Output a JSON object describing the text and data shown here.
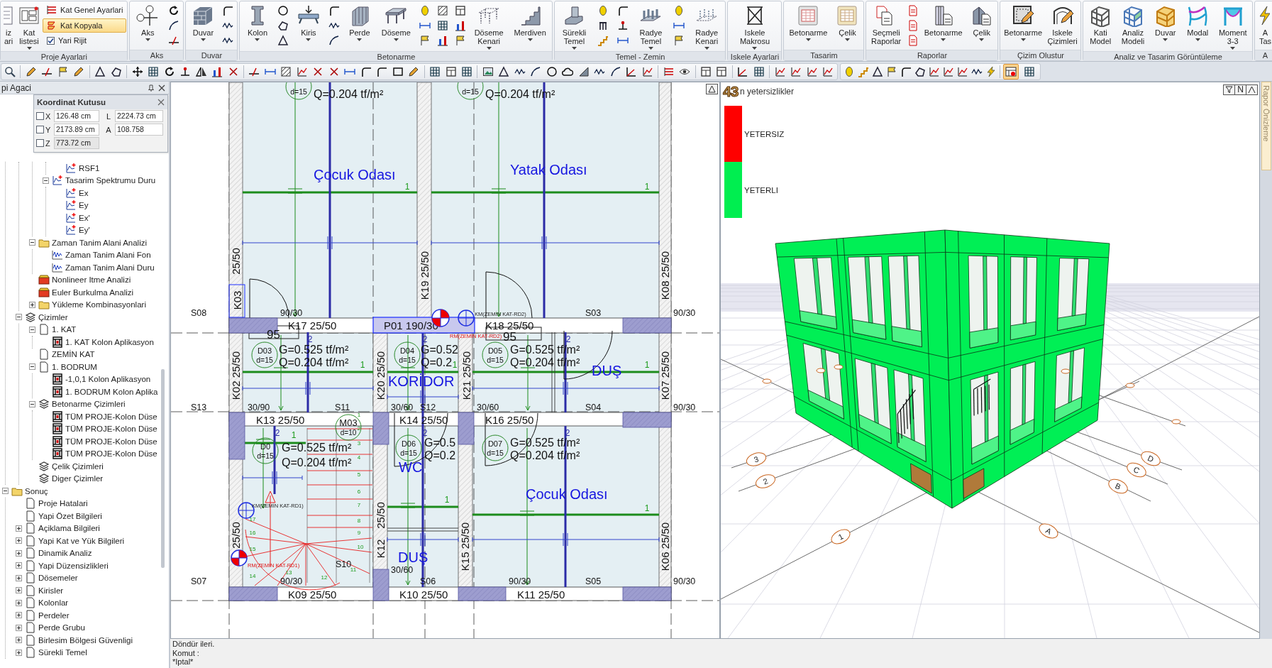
{
  "ribbon": {
    "groups": [
      {
        "label": "Proje Ayarlari",
        "items": [
          {
            "kind": "large",
            "label": "iz ari",
            "dropdown": false
          },
          {
            "kind": "large",
            "label": "Kat listesi",
            "dropdown": true
          },
          {
            "kind": "list",
            "entries": [
              {
                "kind": "button",
                "label": "Kat Genel Ayarlari",
                "selected": false
              },
              {
                "kind": "button",
                "label": "Kat Kopyala",
                "selected": true
              },
              {
                "kind": "checkbox",
                "label": "Yari Rijit",
                "checked": true
              }
            ]
          }
        ]
      },
      {
        "label": "Aks",
        "items": [
          {
            "kind": "large",
            "label": "Aks",
            "dropdown": true
          },
          {
            "kind": "icons"
          }
        ]
      },
      {
        "label": "Duvar",
        "items": [
          {
            "kind": "large",
            "label": "Duvar",
            "dropdown": true
          },
          {
            "kind": "icons"
          }
        ]
      },
      {
        "label": "Betonarme",
        "items": [
          {
            "kind": "large",
            "label": "Kolon",
            "dropdown": true
          },
          {
            "kind": "icons"
          },
          {
            "kind": "large",
            "label": "Kiris",
            "dropdown": true
          },
          {
            "kind": "icons"
          },
          {
            "kind": "large",
            "label": "Perde",
            "dropdown": true
          },
          {
            "kind": "large",
            "label": "Döseme",
            "dropdown": true
          },
          {
            "kind": "icons"
          },
          {
            "kind": "icons"
          },
          {
            "kind": "icons"
          },
          {
            "kind": "large",
            "label": "Döseme Kenari",
            "dropdown": true
          },
          {
            "kind": "large",
            "label": "Merdiven",
            "dropdown": true
          }
        ]
      },
      {
        "label": "Temel - Zemin",
        "items": [
          {
            "kind": "large",
            "label": "Sürekli Temel",
            "dropdown": true
          },
          {
            "kind": "icons"
          },
          {
            "kind": "icons"
          },
          {
            "kind": "large",
            "label": "Radye Temel",
            "dropdown": true
          },
          {
            "kind": "icons"
          },
          {
            "kind": "large",
            "label": "Radye Kenari",
            "dropdown": true
          }
        ]
      },
      {
        "label": "Iskele Ayarlari",
        "items": [
          {
            "kind": "large",
            "label": "Iskele Makrosu",
            "dropdown": true
          }
        ]
      },
      {
        "label": "Tasarim",
        "items": [
          {
            "kind": "large",
            "label": "Betonarme",
            "dropdown": true
          },
          {
            "kind": "large",
            "label": "Çelik",
            "dropdown": true
          }
        ]
      },
      {
        "label": "Raporlar",
        "items": [
          {
            "kind": "large",
            "label": "Seçmeli Raporlar",
            "dropdown": false
          },
          {
            "kind": "icons"
          },
          {
            "kind": "large",
            "label": "Betonarme",
            "dropdown": true
          },
          {
            "kind": "large",
            "label": "Çelik",
            "dropdown": true
          }
        ]
      },
      {
        "label": "Çizim Olustur",
        "items": [
          {
            "kind": "large",
            "label": "Betonarme",
            "dropdown": true
          },
          {
            "kind": "large",
            "label": "Iskele Çizimleri",
            "dropdown": false
          }
        ]
      },
      {
        "label": "Analiz ve Tasarim Görüntüleme",
        "items": [
          {
            "kind": "large",
            "label": "Kati Model",
            "dropdown": false
          },
          {
            "kind": "large",
            "label": "Analiz Modeli",
            "dropdown": false
          },
          {
            "kind": "large",
            "label": "Duvar",
            "dropdown": true
          },
          {
            "kind": "large",
            "label": "Modal",
            "dropdown": true
          },
          {
            "kind": "large",
            "label": "Moment 3-3",
            "dropdown": true
          }
        ]
      },
      {
        "label": "A",
        "items": [
          {
            "kind": "large",
            "label": "A Tas",
            "dropdown": false
          }
        ]
      }
    ]
  },
  "toolbar": {
    "toggles": [
      {
        "pressed": true
      },
      {
        "pressed": false
      }
    ]
  },
  "structure_panel": {
    "title": "pi Agaci",
    "tree": [
      {
        "children": [
          {
            "children": [
              {
                "children": [
                  {
                    "children": [
                      {
                        "label": "RSF1",
                        "kind": "chart"
                      }
                    ]
                  },
                  {
                    "label": "Tasarim Spektrumu Duru",
                    "kind": "chart",
                    "expanded": true,
                    "children": [
                      {
                        "label": "Ex",
                        "kind": "chart"
                      },
                      {
                        "label": "Ey",
                        "kind": "chart"
                      },
                      {
                        "label": "Ex'",
                        "kind": "chart"
                      },
                      {
                        "label": "Ey'",
                        "kind": "chart"
                      }
                    ]
                  }
                ]
              },
              {
                "label": "Zaman Tanim Alani Analizi",
                "kind": "folder",
                "expanded": true,
                "children": [
                  {
                    "label": "Zaman Tanim Alani Fon",
                    "kind": "wave"
                  },
                  {
                    "label": "Zaman Tanim Alani Duru",
                    "kind": "wave"
                  }
                ]
              },
              {
                "label": "Nonlineer Itme Analizi",
                "kind": "box"
              },
              {
                "label": "Euler Burkulma Analizi",
                "kind": "box"
              },
              {
                "label": "Yükleme Kombinasyonlari",
                "kind": "folder",
                "expanded": false
              }
            ]
          },
          {
            "label": "Çizimler",
            "kind": "layers",
            "expanded": true,
            "children": [
              {
                "label": "1. KAT",
                "kind": "page",
                "expanded": true,
                "children": [
                  {
                    "label": "1. KAT Kolon Aplikasyon",
                    "kind": "sheet"
                  }
                ]
              },
              {
                "label": "ZEMİN KAT",
                "kind": "page"
              },
              {
                "label": "1. BODRUM",
                "kind": "page",
                "expanded": true,
                "children": [
                  {
                    "label": "-1,0,1 Kolon Aplikasyon",
                    "kind": "sheet"
                  },
                  {
                    "label": "1. BODRUM Kolon Aplika",
                    "kind": "sheet"
                  }
                ]
              },
              {
                "label": "Betonarme Çizimleri",
                "kind": "layers",
                "expanded": true,
                "children": [
                  {
                    "label": "TÜM PROJE-Kolon Düse",
                    "kind": "sheet"
                  },
                  {
                    "label": "TÜM PROJE-Kolon Düse",
                    "kind": "sheet"
                  },
                  {
                    "label": "TÜM PROJE-Kolon Düse",
                    "kind": "sheet"
                  },
                  {
                    "label": "TÜM PROJE-Kolon Düse",
                    "kind": "sheet"
                  }
                ]
              },
              {
                "label": "Çelik Çizimleri",
                "kind": "layers"
              },
              {
                "label": "Diger Çizimler",
                "kind": "layers"
              }
            ]
          }
        ]
      },
      {
        "label": "Sonuç",
        "kind": "folder",
        "expanded": true,
        "children": [
          {
            "label": "Proje Hatalari",
            "kind": "page"
          },
          {
            "label": "Yapi Özet Bilgileri",
            "kind": "page"
          },
          {
            "label": "Açiklama Bilgileri",
            "kind": "page",
            "expanded": false
          },
          {
            "label": "Yapi Kat ve Yük Bilgileri",
            "kind": "page",
            "expanded": false
          },
          {
            "label": "Dinamik Analiz",
            "kind": "page",
            "expanded": false
          },
          {
            "label": "Yapi Düzensizlikleri",
            "kind": "page",
            "expanded": false
          },
          {
            "label": "Dösemeler",
            "kind": "page",
            "expanded": false
          },
          {
            "label": "Kirisler",
            "kind": "page",
            "expanded": false
          },
          {
            "label": "Kolonlar",
            "kind": "page",
            "expanded": false
          },
          {
            "label": "Perdeler",
            "kind": "page",
            "expanded": false
          },
          {
            "label": "Perde Grubu",
            "kind": "page",
            "expanded": false
          },
          {
            "label": "Birlesim Bölgesi Güvenligi",
            "kind": "page",
            "expanded": false
          },
          {
            "label": "Sürekli Temel",
            "kind": "page",
            "expanded": false
          }
        ]
      }
    ]
  },
  "coordinate_box": {
    "title": "Koordinat Kutusu",
    "rows": [
      {
        "axis": "X",
        "checked": false,
        "value": "126.48 cm",
        "disabled": false,
        "pair_label": "L",
        "pair_value": "2224.73 cm"
      },
      {
        "axis": "Y",
        "checked": false,
        "value": "2173.89 cm",
        "disabled": false,
        "pair_label": "A",
        "pair_value": "108.758"
      },
      {
        "axis": "Z",
        "checked": false,
        "value": "773.72 cm",
        "disabled": true
      }
    ]
  },
  "plan_view": {
    "rooms": [
      "Çocuk Odası",
      "Yatak Odası",
      "KORİDOR",
      "DUŞ",
      "WC",
      "Çocuk Odası",
      "DUŞ"
    ],
    "span_labels": [
      "S08",
      "90/30",
      "S03",
      "90/30",
      "S13",
      "30/90",
      "S11",
      "30/60",
      "S12",
      "30/60",
      "S04",
      "90/30",
      "S10",
      "30/60",
      "S07",
      "90/30",
      "S06",
      "90/30",
      "S05",
      "90/30"
    ],
    "beam_labels": [
      "K17 25/50",
      "P01 190/30",
      "K18 25/50",
      "K13 25/50",
      "K14 25/50",
      "K16 25/50",
      "K09 25/50",
      "K10 25/50",
      "K11 25/50"
    ],
    "column_labels": [
      "25/50",
      "K03",
      "K19 25/50",
      "K08 25/50",
      "K02 25/50",
      "K20 25/50",
      "K21 25/50",
      "K07 25/50",
      "25/50",
      "K12",
      "K15 25/50",
      "K06 25/50",
      "25/50"
    ],
    "slabs": [
      {
        "thickness": "d=15",
        "loads": [
          "Q=0.204 tf/m²"
        ]
      },
      {
        "thickness": "d=15",
        "loads": [
          "Q=0.204 tf/m²"
        ]
      },
      {
        "tag": "D03",
        "thickness": "d=15",
        "loads": [
          "G=0.525 tf/m²",
          "Q=0.204 tf/m²"
        ]
      },
      {
        "tag": "D04",
        "thickness": "d=15",
        "loads": [
          "G=0.52",
          "Q=0.2"
        ]
      },
      {
        "tag": "D05",
        "thickness": "d=15",
        "loads": [
          "G=0.525 tf/m²",
          "Q=0.204 tf/m²"
        ]
      },
      {
        "tag": "D0",
        "thickness": "d=15",
        "loads": [
          "G=0.525 tf/m²",
          "Q=0.204 tf/m²"
        ]
      },
      {
        "tag": "D06",
        "thickness": "d=15",
        "loads": [
          "G=0.5",
          "Q=0.2"
        ]
      },
      {
        "tag": "D07",
        "thickness": "d=15",
        "loads": [
          "G=0.525 tf/m²",
          "Q=0.204 tf/m²"
        ]
      }
    ],
    "stair": {
      "tag": "M03",
      "thickness": "d=10",
      "steps": [
        "1",
        "2",
        "3",
        "4",
        "5",
        "6",
        "7",
        "8",
        "9",
        "10",
        "11",
        "12",
        "13",
        "17",
        "16",
        "15",
        "14"
      ]
    },
    "markers": [
      {
        "kind": "quadrant",
        "label": "RM(ZEMİN KAT-RD2)"
      },
      {
        "kind": "crosshair",
        "label": "KM(ZEMİN KAT-RD2)"
      },
      {
        "kind": "crosshair",
        "label": "KM(ZEMİN KAT-RD1)"
      },
      {
        "kind": "quadrant",
        "label": "RM(ZEMİN KAT-RD1)"
      }
    ],
    "door_widths": [
      "95",
      "95"
    ],
    "direction_marks": [
      "1",
      "1",
      "1",
      "1",
      "1",
      "1",
      "1",
      "1"
    ],
    "span_marks": [
      "2",
      "2",
      "2",
      "2",
      "2",
      "2"
    ]
  },
  "model_view": {
    "badge": "43",
    "title": "n yetersizlikler",
    "legend": [
      {
        "label": "YETERSIZ",
        "color": "#ff0000"
      },
      {
        "label": "YETERLI",
        "color": "#00ee50"
      }
    ],
    "axis_labels": [
      "1",
      "2",
      "3",
      "A",
      "B",
      "C",
      "D"
    ],
    "view_buttons": [
      "N"
    ]
  },
  "side_tab": {
    "label": "Rapor Önizleme"
  },
  "command_area": {
    "lines": [
      "Döndür ileri.",
      "Komut :",
      "*Iptal*"
    ]
  }
}
